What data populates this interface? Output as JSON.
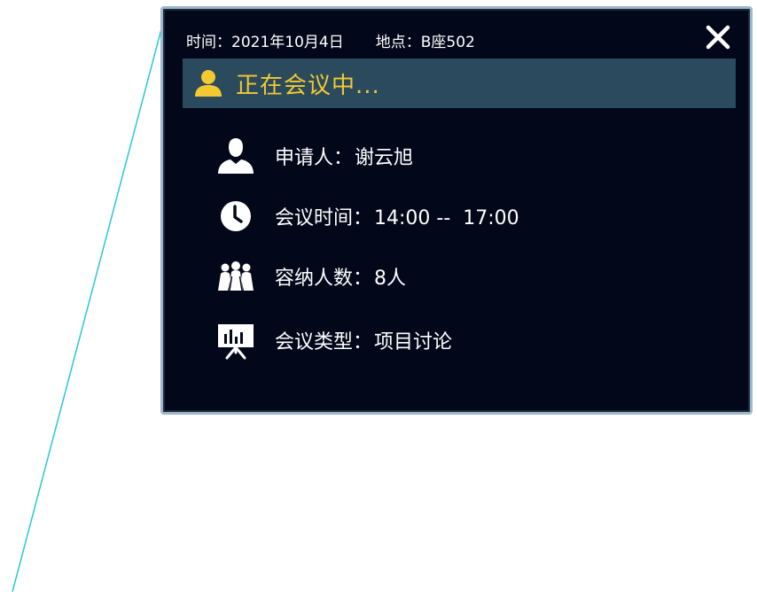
{
  "header": {
    "time_label": "时间：",
    "date": "2021年10月4日",
    "location_label": "地点：",
    "location": "B座502"
  },
  "status": {
    "text": "正在会议中..."
  },
  "details": {
    "applicant_label": "申请人：",
    "applicant": "谢云旭",
    "meeting_time_label": "会议时间：",
    "meeting_time": "14:00 --  17:00",
    "capacity_label": "容纳人数：",
    "capacity": "8人",
    "meeting_type_label": "会议类型：",
    "meeting_type": "项目讨论"
  },
  "icons": {
    "close": "close-icon",
    "status": "person-icon",
    "applicant": "user-icon",
    "time": "clock-icon",
    "capacity": "people-group-icon",
    "type": "presentation-board-icon"
  },
  "colors": {
    "panel_bg": "#03071a",
    "panel_border": "#9cb6cc",
    "status_bar_bg": "#2b4a5e",
    "status_accent": "#f2c931",
    "text": "#ffffff",
    "leader_line": "#29c6dc"
  }
}
